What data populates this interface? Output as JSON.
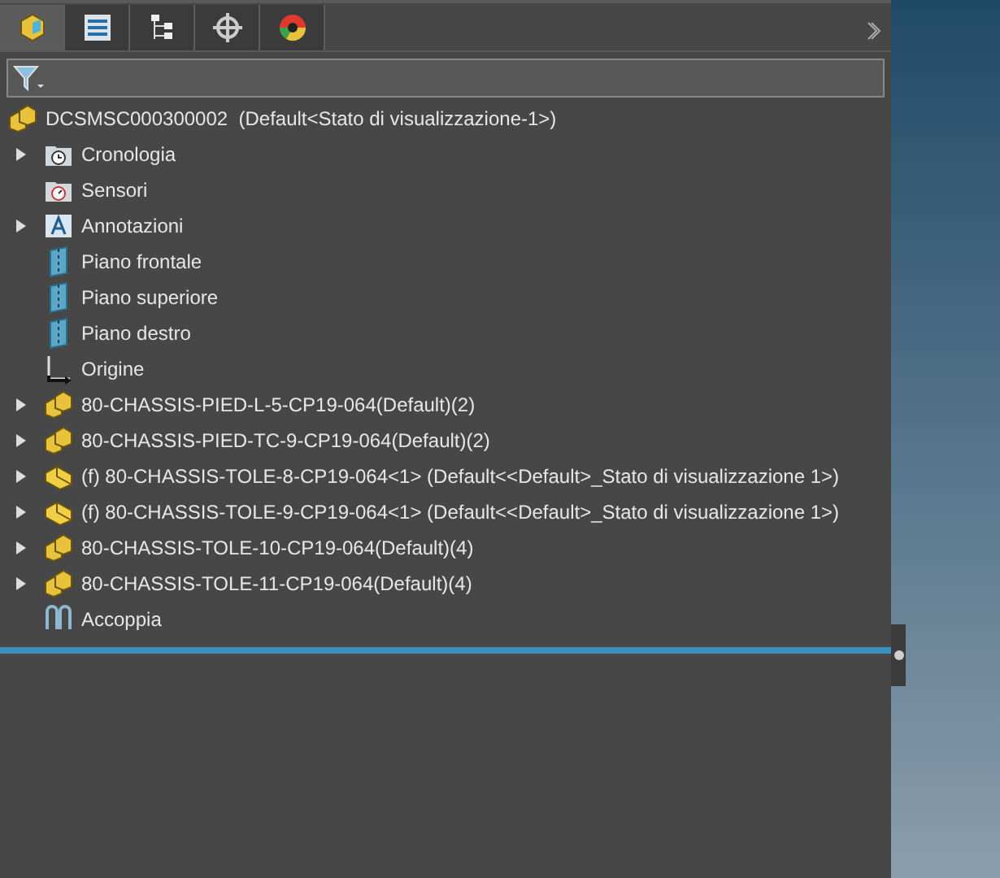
{
  "tabs": [
    {
      "kind": "feature",
      "selected": true
    },
    {
      "kind": "property",
      "selected": false
    },
    {
      "kind": "config",
      "selected": false
    },
    {
      "kind": "target",
      "selected": false
    },
    {
      "kind": "appearance",
      "selected": false
    }
  ],
  "root": {
    "label": "DCSMSC000300002  (Default<Stato di visualizzazione-1>)"
  },
  "tree": [
    {
      "kind": "history",
      "label": "Cronologia",
      "expandable": true
    },
    {
      "kind": "sensor",
      "label": "Sensori",
      "expandable": false
    },
    {
      "kind": "annotation",
      "label": "Annotazioni",
      "expandable": true
    },
    {
      "kind": "plane",
      "label": "Piano frontale",
      "expandable": false
    },
    {
      "kind": "plane",
      "label": "Piano superiore",
      "expandable": false
    },
    {
      "kind": "plane",
      "label": "Piano destro",
      "expandable": false
    },
    {
      "kind": "origin",
      "label": "Origine",
      "expandable": false
    },
    {
      "kind": "assembly",
      "label": "80-CHASSIS-PIED-L-5-CP19-064(Default)(2)",
      "expandable": true
    },
    {
      "kind": "assembly",
      "label": "80-CHASSIS-PIED-TC-9-CP19-064(Default)(2)",
      "expandable": true
    },
    {
      "kind": "part",
      "label": "(f) 80-CHASSIS-TOLE-8-CP19-064<1> (Default<<Default>_Stato di visualizzazione 1>)",
      "expandable": true
    },
    {
      "kind": "part",
      "label": "(f) 80-CHASSIS-TOLE-9-CP19-064<1> (Default<<Default>_Stato di visualizzazione 1>)",
      "expandable": true
    },
    {
      "kind": "assembly",
      "label": "80-CHASSIS-TOLE-10-CP19-064(Default)(4)",
      "expandable": true
    },
    {
      "kind": "assembly",
      "label": "80-CHASSIS-TOLE-11-CP19-064(Default)(4)",
      "expandable": true
    },
    {
      "kind": "mate",
      "label": "Accoppia",
      "expandable": false
    }
  ]
}
